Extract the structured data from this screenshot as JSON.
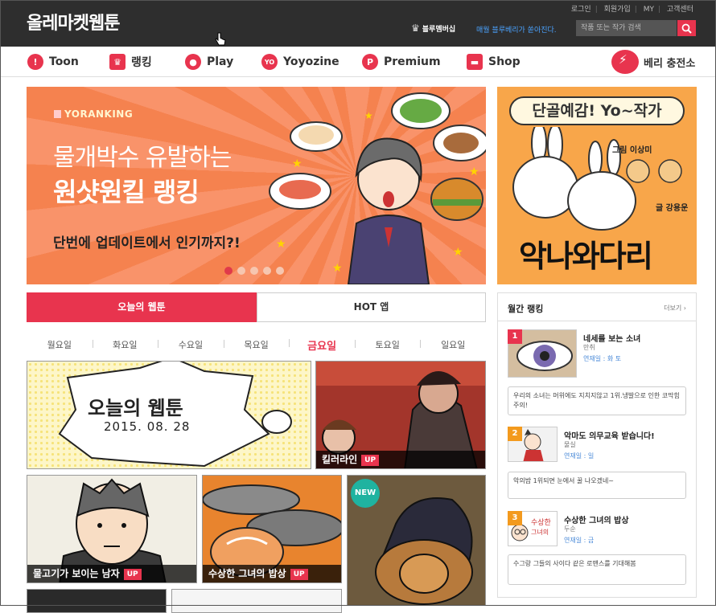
{
  "header": {
    "logo": "올레마켓웹툰",
    "links": [
      "로그인",
      "회원가입",
      "MY",
      "고객센터"
    ],
    "membership": "블루멤버십",
    "promo": "매월 블루베리가 쏟아진다.",
    "search_placeholder": "작품 또는 작가 검색"
  },
  "nav": {
    "items": [
      {
        "label": "Toon",
        "icon": "exclaim-icon"
      },
      {
        "label": "랭킹",
        "icon": "trophy-icon"
      },
      {
        "label": "Play",
        "icon": "balloon-icon"
      },
      {
        "label": "Yoyozine",
        "icon": "yo-icon"
      },
      {
        "label": "Premium",
        "icon": "p-icon"
      },
      {
        "label": "Shop",
        "icon": "bag-icon"
      }
    ],
    "berry": "베리 충전소"
  },
  "hero": {
    "tag": "YORANKING",
    "line1": "물개박수 유발하는",
    "line2": "원샷원킬 랭킹",
    "line3": "단번에 업데이트에서 인기까지?!",
    "slide_count": 5,
    "active_slide": 1
  },
  "side_banner": {
    "title": "단골예감! Yo~작가",
    "author1": "그림 이상미",
    "author2": "글 강용운",
    "big_title": "악나와다리"
  },
  "tabs": {
    "today": "오늘의 웹툰",
    "hot": "HOT 앱"
  },
  "days": [
    "월요일",
    "화요일",
    "수요일",
    "목요일",
    "금요일",
    "토요일",
    "일요일"
  ],
  "active_day": "금요일",
  "today_card": {
    "title": "오늘의 웹툰",
    "date": "2015. 08. 28"
  },
  "cards": {
    "killer": {
      "title": "킬러라인",
      "badge": "UP"
    },
    "fish": {
      "title": "물고기가 보이는 남자",
      "badge": "UP"
    },
    "table": {
      "title": "수상한 그녀의 밥상",
      "badge": "UP"
    },
    "lion": {
      "badge": "NEW"
    }
  },
  "ranking": {
    "title": "월간 랭킹",
    "more": "더보기 ›",
    "items": [
      {
        "rank": "1",
        "name": "네세를 보는 소녀",
        "author": "만취",
        "day": "연재일 : 화 토",
        "comment": "우리의 소녀는 머위에도 지치지않고 1위.냉발으로 인한 코막힘 주의!"
      },
      {
        "rank": "2",
        "name": "악마도 의무교육 받습니다!",
        "author": "물실",
        "day": "연재일 : 일",
        "comment": "악의밤 1위되면 눈에서 꿀 나오겠네~"
      },
      {
        "rank": "3",
        "name": "수상한 그녀의 밥상",
        "author": "두순",
        "day": "연재일 : 금",
        "comment": "수그랑 그들의 사이다 같은 로맨스를 기대해봄"
      }
    ]
  }
}
